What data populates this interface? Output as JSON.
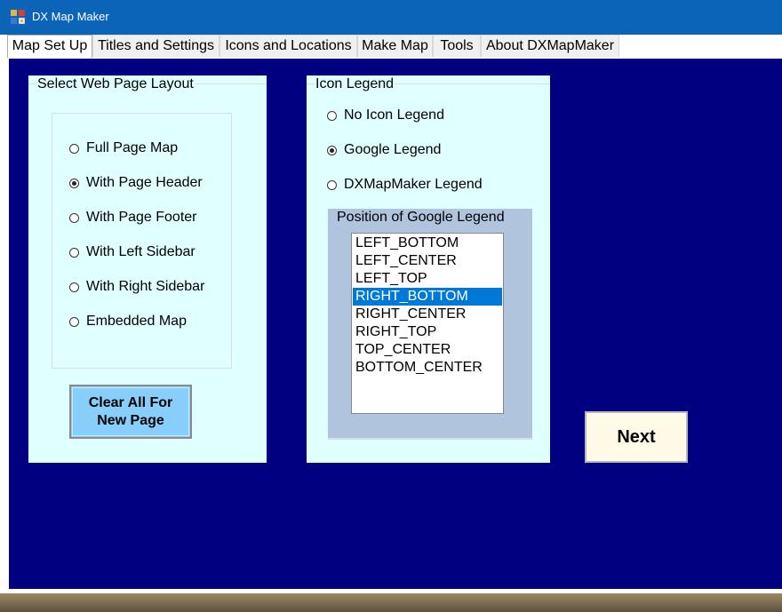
{
  "window": {
    "title": "DX Map Maker"
  },
  "tabs": [
    {
      "label": "Map Set Up",
      "active": true
    },
    {
      "label": "Titles and Settings"
    },
    {
      "label": "Icons and Locations"
    },
    {
      "label": "Make Map"
    },
    {
      "label": "Tools"
    },
    {
      "label": "About DXMapMaker"
    }
  ],
  "layout_group": {
    "title": "Select Web Page Layout",
    "options": [
      {
        "label": "Full Page Map",
        "checked": false
      },
      {
        "label": "With Page Header",
        "checked": true
      },
      {
        "label": "With Page Footer",
        "checked": false
      },
      {
        "label": "With Left Sidebar",
        "checked": false
      },
      {
        "label": "With Right Sidebar",
        "checked": false
      },
      {
        "label": "Embedded Map",
        "checked": false
      }
    ],
    "clear_button": "Clear All For\nNew Page"
  },
  "legend_group": {
    "title": "Icon Legend",
    "options": [
      {
        "label": "No Icon Legend",
        "checked": false
      },
      {
        "label": "Google Legend",
        "checked": true
      },
      {
        "label": "DXMapMaker Legend",
        "checked": false
      }
    ],
    "position": {
      "title": "Position of Google Legend",
      "items": [
        "LEFT_BOTTOM",
        "LEFT_CENTER",
        "LEFT_TOP",
        "RIGHT_BOTTOM",
        "RIGHT_CENTER",
        "RIGHT_TOP",
        "TOP_CENTER",
        "BOTTOM_CENTER"
      ],
      "selected": "RIGHT_BOTTOM"
    }
  },
  "next_button": "Next",
  "colors": {
    "titlebar": "#0b64b7",
    "content_bg": "#000080",
    "panel_bg": "#e0ffff",
    "clear_button_bg": "#87cefa",
    "list_selection": "#0078d7",
    "next_button_bg": "#fffbe6"
  }
}
